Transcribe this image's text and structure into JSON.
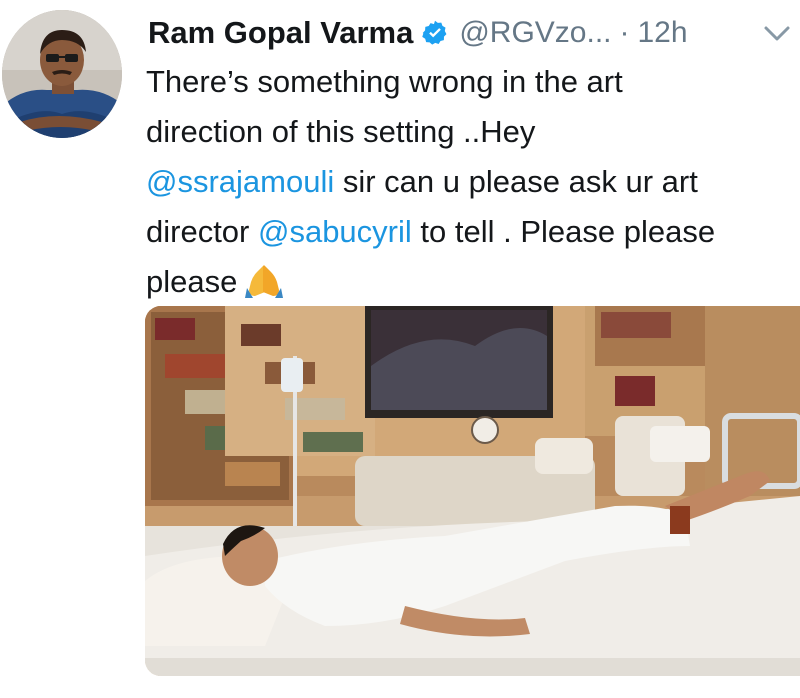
{
  "tweet": {
    "display_name": "Ram Gopal Varma",
    "handle": "@RGVzo...",
    "separator": "·",
    "time": "12h",
    "text": {
      "line1": "There’s something wrong in the art",
      "line2": "direction of this setting ..Hey",
      "mention1": "@ssrajamouli",
      "line3_rest": " sir can u please ask ur art",
      "line4_start": "director ",
      "mention2": "@sabucyril",
      "line4_rest": " to tell . Please please",
      "line5": "please"
    },
    "icons": {
      "verified": "verified-badge-icon",
      "more": "chevron-down-icon",
      "emoji": "folded-hands-emoji"
    },
    "colors": {
      "link": "#1b95e0",
      "secondary_text": "#657786",
      "verified": "#1da1f2"
    }
  }
}
